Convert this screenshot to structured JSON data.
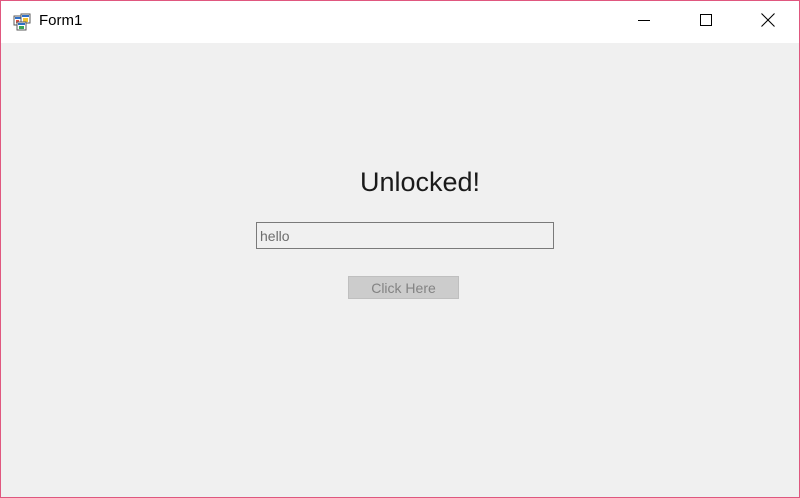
{
  "window": {
    "title": "Form1",
    "icon": "winforms-app-icon",
    "border_color": "#e0577f",
    "controls": {
      "minimize": "minimize-icon",
      "maximize": "maximize-icon",
      "close": "close-icon"
    }
  },
  "form": {
    "status_label": "Unlocked!",
    "input_value": "hello",
    "button_label": "Click Here",
    "button_enabled": false,
    "input_enabled": false
  },
  "colors": {
    "client_background": "#f0f0f0",
    "titlebar_background": "#ffffff"
  }
}
